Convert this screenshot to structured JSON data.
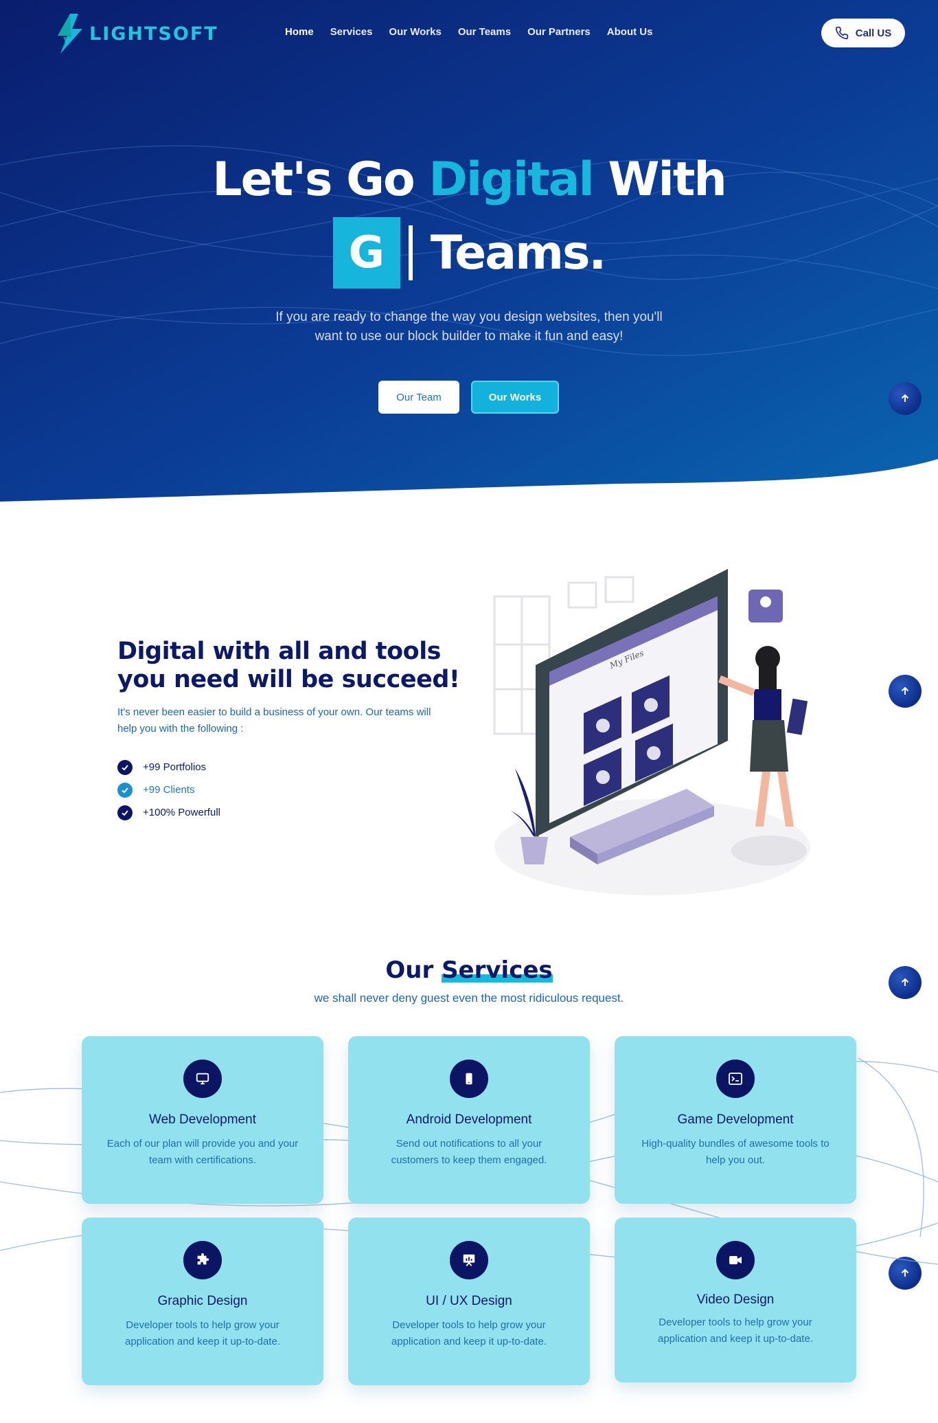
{
  "brand": {
    "name": "LIGHTSOFT"
  },
  "nav": {
    "items": [
      {
        "label": "Home",
        "active": true
      },
      {
        "label": "Services"
      },
      {
        "label": "Our Works"
      },
      {
        "label": "Our Teams"
      },
      {
        "label": "Our Partners"
      },
      {
        "label": "About Us"
      }
    ],
    "call_label": "Call US",
    "call_icon": "phone-icon"
  },
  "hero": {
    "title_part1": "Let's Go ",
    "title_accent": "Digital",
    "title_part2": " With",
    "typed_letter": "G",
    "title_line2": "Teams.",
    "subtitle": "If you are ready to change the way you design websites, then you'll want to use our block builder to make it fun and easy!",
    "btn_team": "Our Team",
    "btn_works": "Our Works"
  },
  "feature": {
    "title_line1": "Digital with all and tools",
    "title_line2_pre": "you need will be ",
    "title_highlight": "succeed!",
    "description": "It's never been easier to build a business of your own. Our teams will help you with the following :",
    "list": [
      "+99 Portfolios",
      "+99 Clients",
      "+100% Powerfull"
    ],
    "illustration_label": "My Files"
  },
  "services": {
    "title_pre": "Our ",
    "title_highlight": "Services",
    "subtitle": "we shall never deny guest even the most ridiculous request.",
    "cards": [
      {
        "icon": "monitor-icon",
        "title": "Web Development",
        "desc": "Each of our plan will provide you and your team with certifications."
      },
      {
        "icon": "mobile-icon",
        "title": "Android Development",
        "desc": "Send out notifications to all your customers to keep them engaged."
      },
      {
        "icon": "terminal-icon",
        "title": "Game Development",
        "desc": "High-quality bundles of awesome tools to help you out."
      },
      {
        "icon": "puzzle-icon",
        "title": "Graphic Design",
        "desc": "Developer tools to help grow your application and keep it up-to-date."
      },
      {
        "icon": "presentation-icon",
        "title": "UI / UX Design",
        "desc": "Developer tools to help grow your application and keep it up-to-date."
      },
      {
        "icon": "video-icon",
        "title": "Video Design",
        "desc": "Developer tools to help grow your application and keep it up-to-date."
      }
    ]
  },
  "colors": {
    "hero_dark": "#0a1d6e",
    "hero_light": "#0a62ad",
    "accent": "#16b8de",
    "navy": "#0b1a68",
    "card_bg": "#92e1ef"
  }
}
